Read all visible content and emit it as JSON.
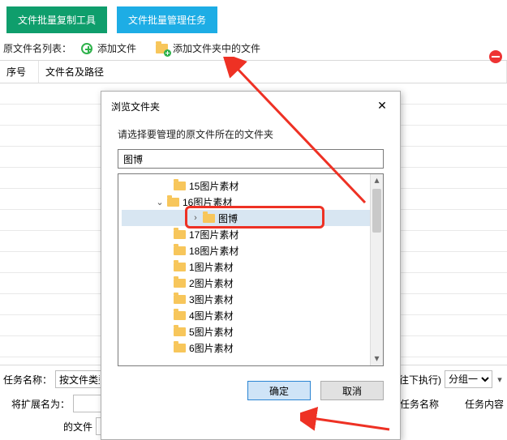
{
  "topbar": {
    "btn_copy": "文件批量复制工具",
    "btn_task": "文件批量管理任务"
  },
  "row": {
    "list_label": "原文件名列表：",
    "add_file": "添加文件",
    "add_folder_files": "添加文件夹中的文件"
  },
  "grid": {
    "col_seq": "序号",
    "col_path": "文件名及路径"
  },
  "bottom": {
    "task_name_lbl": "任务名称：",
    "task_name_val": "按文件类型",
    "after_done": "往下执行)",
    "group_opt": "分组一",
    "ext_lbl": "将扩展名为：",
    "taskname_hdr": "任务名称",
    "taskcontent_hdr": "任务内容",
    "of_file": "的文件"
  },
  "dialog": {
    "title": "浏览文件夹",
    "msg": "请选择要管理的原文件所在的文件夹",
    "path": "图博",
    "nodes": [
      {
        "label": "15图片素材",
        "depth": 0
      },
      {
        "label": "16图片素材",
        "depth": 0,
        "expanded": true
      },
      {
        "label": "图博",
        "depth": 1,
        "selected": true
      },
      {
        "label": "17图片素材",
        "depth": 0
      },
      {
        "label": "18图片素材",
        "depth": 0
      },
      {
        "label": "1图片素材",
        "depth": 0
      },
      {
        "label": "2图片素材",
        "depth": 0
      },
      {
        "label": "3图片素材",
        "depth": 0
      },
      {
        "label": "4图片素材",
        "depth": 0
      },
      {
        "label": "5图片素材",
        "depth": 0
      },
      {
        "label": "6图片素材",
        "depth": 0
      }
    ],
    "ok": "确定",
    "cancel": "取消"
  }
}
